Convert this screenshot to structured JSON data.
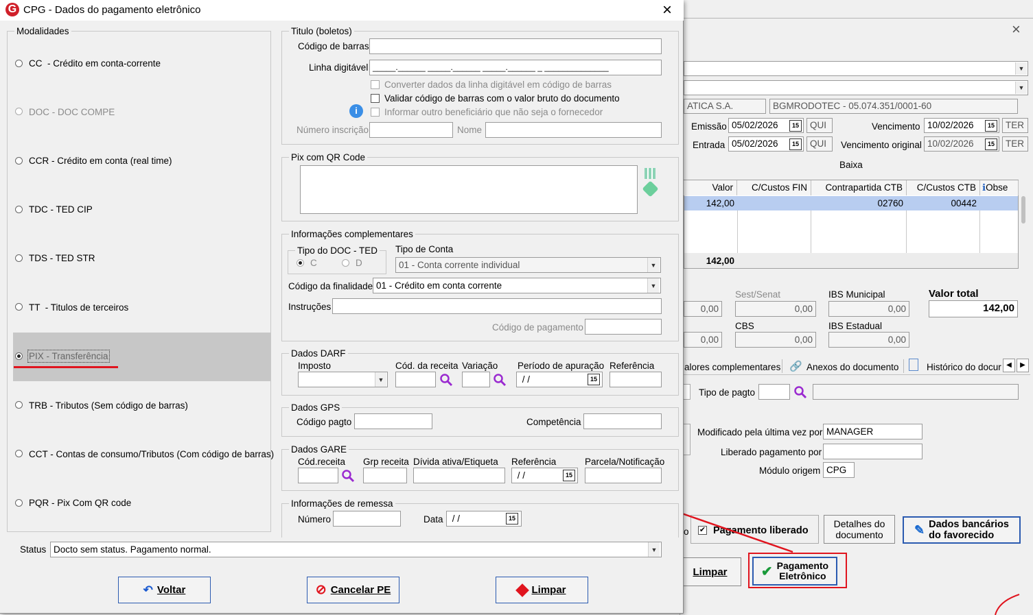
{
  "dialog": {
    "title": "CPG - Dados do pagamento eletrônico",
    "close_label": "×"
  },
  "modalidades": {
    "legend": "Modalidades",
    "items": [
      {
        "label": "CC  - Crédito em conta-corrente",
        "enabled": true,
        "selected": false
      },
      {
        "label": "DOC - DOC COMPE",
        "enabled": false,
        "selected": false
      },
      {
        "label": "CCR - Crédito em conta (real time)",
        "enabled": true,
        "selected": false
      },
      {
        "label": "TDC - TED CIP",
        "enabled": true,
        "selected": false
      },
      {
        "label": "TDS - TED STR",
        "enabled": true,
        "selected": false
      },
      {
        "label": "TT  - Titulos de terceiros",
        "enabled": true,
        "selected": false
      },
      {
        "label": "PIX - Transferência",
        "enabled": true,
        "selected": true
      },
      {
        "label": "TRB - Tributos (Sem código de barras)",
        "enabled": true,
        "selected": false
      },
      {
        "label": "CCT - Contas de consumo/Tributos (Com código de barras)",
        "enabled": true,
        "selected": false
      },
      {
        "label": "PQR - Pix Com QR code",
        "enabled": true,
        "selected": false
      }
    ]
  },
  "titulo": {
    "legend": "Titulo (boletos)",
    "codigo_barras_label": "Código de barras",
    "codigo_barras_value": "",
    "linha_digitavel_label": "Linha digitável",
    "linha_digitavel_value": "_____.______ _____.______ _____.______ _ ______________",
    "chk_converter": "Converter dados da linha digitável em código de barras",
    "chk_validar": "Validar código de barras com o valor bruto do documento",
    "chk_informar": "Informar outro beneficiário que não seja o fornecedor",
    "numero_inscricao_label": "Número inscrição",
    "nome_label": "Nome"
  },
  "pix_qr": {
    "legend": "Pix com QR Code"
  },
  "info_compl": {
    "legend": "Informações complementares",
    "tipo_doc_legend": "Tipo do DOC - TED",
    "radio_c": "C",
    "radio_d": "D",
    "tipo_conta_label": "Tipo de Conta",
    "tipo_conta_value": "01 - Conta corrente individual",
    "finalidade_label": "Código da finalidade",
    "finalidade_value": "01 - Crédito em conta corrente",
    "instrucoes_label": "Instruções",
    "codigo_pagamento_label": "Código de pagamento"
  },
  "darf": {
    "legend": "Dados DARF",
    "imposto_label": "Imposto",
    "cod_receita_label": "Cód. da receita",
    "variacao_label": "Variação",
    "periodo_label": "Período de apuração",
    "periodo_value": " / /",
    "referencia_label": "Referência"
  },
  "gps": {
    "legend": "Dados GPS",
    "codigo_pagto_label": "Código pagto",
    "competencia_label": "Competência"
  },
  "gare": {
    "legend": "Dados GARE",
    "cod_receita_label": "Cód.receita",
    "grp_receita_label": "Grp receita",
    "divida_label": "Dívida ativa/Etiqueta",
    "referencia_label": "Referência",
    "referencia_value": " / /",
    "parcela_label": "Parcela/Notificação"
  },
  "remessa": {
    "legend": "Informações de remessa",
    "numero_label": "Número",
    "data_label": "Data",
    "data_value": " / /"
  },
  "status": {
    "label": "Status",
    "value": "Docto sem status. Pagamento normal."
  },
  "buttons": {
    "voltar": "Voltar",
    "cancelar": "Cancelar PE",
    "limpar": "Limpar"
  },
  "background": {
    "close_label": "×",
    "empresa_text": "ATICA S.A.",
    "fornecedor_text": "BGMRODOTEC - 05.074.351/0001-60",
    "emissao_label": "Emissão",
    "emissao_value": "05/02/2026",
    "emissao_dia": "QUI",
    "vencimento_label": "Vencimento",
    "vencimento_value": "10/02/2026",
    "vencimento_dia": "TER",
    "entrada_label": "Entrada",
    "entrada_value": "05/02/2026",
    "entrada_dia": "QUI",
    "venc_original_label": "Vencimento original",
    "venc_original_value": "10/02/2026",
    "venc_original_dia": "TER",
    "baixa_label": "Baixa",
    "grid_headers": [
      "Valor",
      "C/Custos FIN",
      "Contrapartida CTB",
      "C/Custos CTB",
      "Obse"
    ],
    "grid_row": [
      "142,00",
      "",
      "02760",
      "00442",
      ""
    ],
    "grid_total": "142,00",
    "sest_label": "Sest/Senat",
    "ibs_mun_label": "IBS Municipal",
    "valor_total_label": "Valor total",
    "cbs_label": "CBS",
    "ibs_est_label": "IBS Estadual",
    "zero": "0,00",
    "valor_total_value": "142,00",
    "tab_valores": "alores complementares",
    "tab_anexos": "Anexos do documento",
    "tab_historico": "Histórico do docur",
    "tipo_pagto_label": "Tipo de pagto",
    "modificado_label": "Modificado pela última vez por",
    "modificado_value": "MANAGER",
    "liberado_label": "Liberado pagamento por",
    "modulo_label": "Módulo origem",
    "modulo_value": "CPG",
    "pagamento_liberado_label": "Pagamento liberado",
    "detalhes_label_1": "Detalhes do",
    "detalhes_label_2": "documento",
    "dados_bancarios_1": "Dados bancários",
    "dados_bancarios_2": "do favorecido",
    "limpar_label": "Limpar",
    "pagamento_eletronico_1": "Pagamento",
    "pagamento_eletronico_2": "Eletrônico",
    "o_label": "o"
  },
  "colors": {
    "annotation_red": "#e0141e",
    "grid_selected": "#b8cdf0",
    "dialog_bg": "#f0f0f0",
    "selected_row_bg": "#c7c7c7"
  }
}
